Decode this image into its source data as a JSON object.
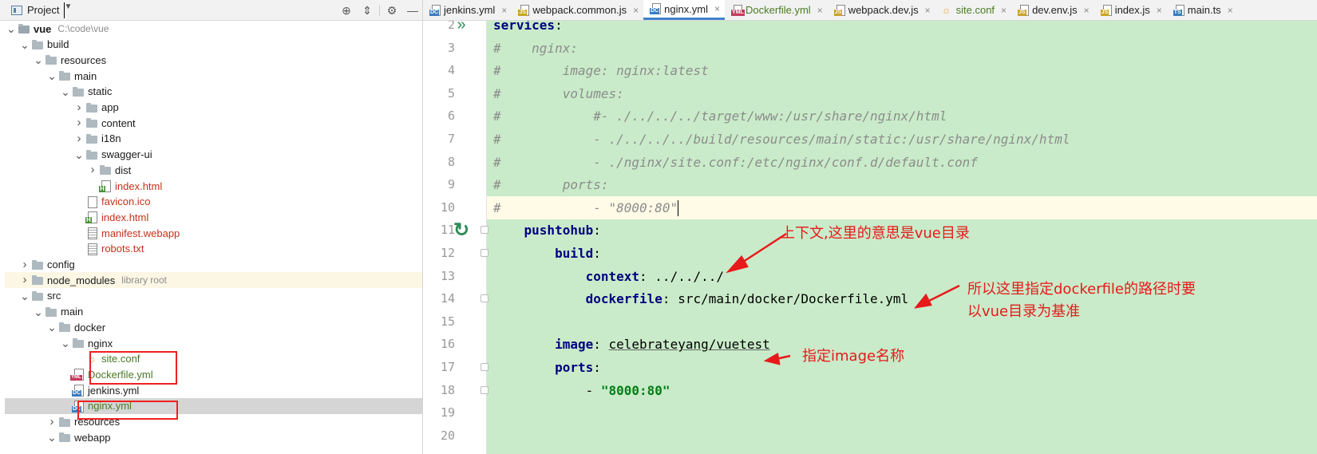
{
  "project_panel": {
    "title": "Project",
    "tools": [
      "target-icon",
      "collapse-icon",
      "gear-icon",
      "minimize-icon"
    ]
  },
  "tree": [
    {
      "label": "vue",
      "hint": "C:\\code\\vue",
      "type": "root-folder",
      "depth": 0,
      "arrow": "down"
    },
    {
      "label": "build",
      "type": "folder",
      "depth": 1,
      "arrow": "down"
    },
    {
      "label": "resources",
      "type": "folder",
      "depth": 2,
      "arrow": "down"
    },
    {
      "label": "main",
      "type": "folder",
      "depth": 3,
      "arrow": "down"
    },
    {
      "label": "static",
      "type": "folder",
      "depth": 4,
      "arrow": "down"
    },
    {
      "label": "app",
      "type": "folder",
      "depth": 5,
      "arrow": "right"
    },
    {
      "label": "content",
      "type": "folder",
      "depth": 5,
      "arrow": "right"
    },
    {
      "label": "i18n",
      "type": "folder",
      "depth": 5,
      "arrow": "right"
    },
    {
      "label": "swagger-ui",
      "type": "folder",
      "depth": 5,
      "arrow": "down"
    },
    {
      "label": "dist",
      "type": "folder",
      "depth": 6,
      "arrow": "right"
    },
    {
      "label": "index.html",
      "type": "html",
      "depth": 6,
      "color": "red"
    },
    {
      "label": "favicon.ico",
      "type": "file",
      "depth": 5,
      "color": "red"
    },
    {
      "label": "index.html",
      "type": "html",
      "depth": 5,
      "color": "red"
    },
    {
      "label": "manifest.webapp",
      "type": "txt",
      "depth": 5,
      "color": "red"
    },
    {
      "label": "robots.txt",
      "type": "txt",
      "depth": 5,
      "color": "red"
    },
    {
      "label": "config",
      "type": "folder",
      "depth": 1,
      "arrow": "right"
    },
    {
      "label": "node_modules",
      "hint": "library root",
      "type": "folder",
      "depth": 1,
      "arrow": "right",
      "lib": true
    },
    {
      "label": "src",
      "type": "folder",
      "depth": 1,
      "arrow": "down"
    },
    {
      "label": "main",
      "type": "folder",
      "depth": 2,
      "arrow": "down"
    },
    {
      "label": "docker",
      "type": "folder",
      "depth": 3,
      "arrow": "down"
    },
    {
      "label": "nginx",
      "type": "folder",
      "depth": 4,
      "arrow": "down"
    },
    {
      "label": "site.conf",
      "type": "conf",
      "depth": 5,
      "color": "green"
    },
    {
      "label": "Dockerfile.yml",
      "type": "yml",
      "depth": 4,
      "color": "green"
    },
    {
      "label": "jenkins.yml",
      "type": "dc",
      "depth": 4
    },
    {
      "label": "nginx.yml",
      "type": "dc",
      "depth": 4,
      "color": "green",
      "selected": true
    },
    {
      "label": "resources",
      "type": "folder",
      "depth": 3,
      "arrow": "right"
    },
    {
      "label": "webapp",
      "type": "folder",
      "depth": 3,
      "arrow": "down"
    }
  ],
  "tabs": [
    {
      "label": "jenkins.yml",
      "icon": "dc"
    },
    {
      "label": "webpack.common.js",
      "icon": "js"
    },
    {
      "label": "nginx.yml",
      "icon": "dc",
      "active": true
    },
    {
      "label": "Dockerfile.yml",
      "icon": "yml",
      "color": "green"
    },
    {
      "label": "webpack.dev.js",
      "icon": "js"
    },
    {
      "label": "site.conf",
      "icon": "conf",
      "color": "green"
    },
    {
      "label": "dev.env.js",
      "icon": "js"
    },
    {
      "label": "index.js",
      "icon": "js"
    },
    {
      "label": "main.ts",
      "icon": "ts"
    }
  ],
  "code_lines": [
    {
      "n": "2",
      "segs": [
        {
          "t": "services",
          "c": "key"
        },
        {
          "t": ":"
        }
      ],
      "gicon": "run-icon"
    },
    {
      "n": "3",
      "segs": [
        {
          "t": "#    nginx:",
          "c": "cm"
        }
      ]
    },
    {
      "n": "4",
      "segs": [
        {
          "t": "#        image: nginx:latest",
          "c": "cm"
        }
      ]
    },
    {
      "n": "5",
      "segs": [
        {
          "t": "#        volumes:",
          "c": "cm"
        }
      ]
    },
    {
      "n": "6",
      "segs": [
        {
          "t": "#            #- ./../../../target/www:/usr/share/nginx/html",
          "c": "cm"
        }
      ]
    },
    {
      "n": "7",
      "segs": [
        {
          "t": "#            - ./../../../build/resources/main/static:/usr/share/nginx/html",
          "c": "cm"
        }
      ]
    },
    {
      "n": "8",
      "segs": [
        {
          "t": "#            - ./nginx/site.conf:/etc/nginx/conf.d/default.conf",
          "c": "cm"
        }
      ]
    },
    {
      "n": "9",
      "segs": [
        {
          "t": "#        ports:",
          "c": "cm"
        }
      ]
    },
    {
      "n": "10",
      "segs": [
        {
          "t": "#            - \"8000:80\"",
          "c": "cm"
        }
      ],
      "current": true
    },
    {
      "n": "11",
      "segs": [
        {
          "t": "    "
        },
        {
          "t": "pushtohub",
          "c": "key"
        },
        {
          "t": ":"
        }
      ],
      "gicon": "rerun-icon",
      "fold": true
    },
    {
      "n": "12",
      "segs": [
        {
          "t": "        "
        },
        {
          "t": "build",
          "c": "key"
        },
        {
          "t": ":"
        }
      ],
      "fold": true
    },
    {
      "n": "13",
      "segs": [
        {
          "t": "            "
        },
        {
          "t": "context",
          "c": "key"
        },
        {
          "t": ": ../../../"
        }
      ]
    },
    {
      "n": "14",
      "segs": [
        {
          "t": "            "
        },
        {
          "t": "dockerfile",
          "c": "key"
        },
        {
          "t": ": src/main/docker/Dockerfile.yml"
        }
      ],
      "fold": true
    },
    {
      "n": "15",
      "segs": [
        {
          "t": ""
        }
      ]
    },
    {
      "n": "16",
      "segs": [
        {
          "t": "        "
        },
        {
          "t": "image",
          "c": "key"
        },
        {
          "t": ": "
        },
        {
          "t": "celebrateyang/vuetest",
          "c": "uline"
        }
      ]
    },
    {
      "n": "17",
      "segs": [
        {
          "t": "        "
        },
        {
          "t": "ports",
          "c": "key"
        },
        {
          "t": ":"
        }
      ],
      "fold": true
    },
    {
      "n": "18",
      "segs": [
        {
          "t": "            - "
        },
        {
          "t": "\"8000:80\"",
          "c": "str"
        }
      ],
      "fold": true
    },
    {
      "n": "19",
      "segs": [
        {
          "t": ""
        }
      ]
    },
    {
      "n": "20",
      "segs": [
        {
          "t": ""
        }
      ]
    }
  ],
  "annotations": {
    "a1": "上下文,这里的意思是vue目录",
    "a2_line1": "所以这里指定dockerfile的路径时要",
    "a2_line2": "以vue目录为基准",
    "a3": "指定image名称"
  },
  "colors": {
    "editor_bg": "#c9ebc9",
    "annotation": "#e8191b",
    "keyword": "#000080",
    "comment": "#8c8c8c",
    "string": "#067d17",
    "active_tab_underline": "#4083c9"
  }
}
